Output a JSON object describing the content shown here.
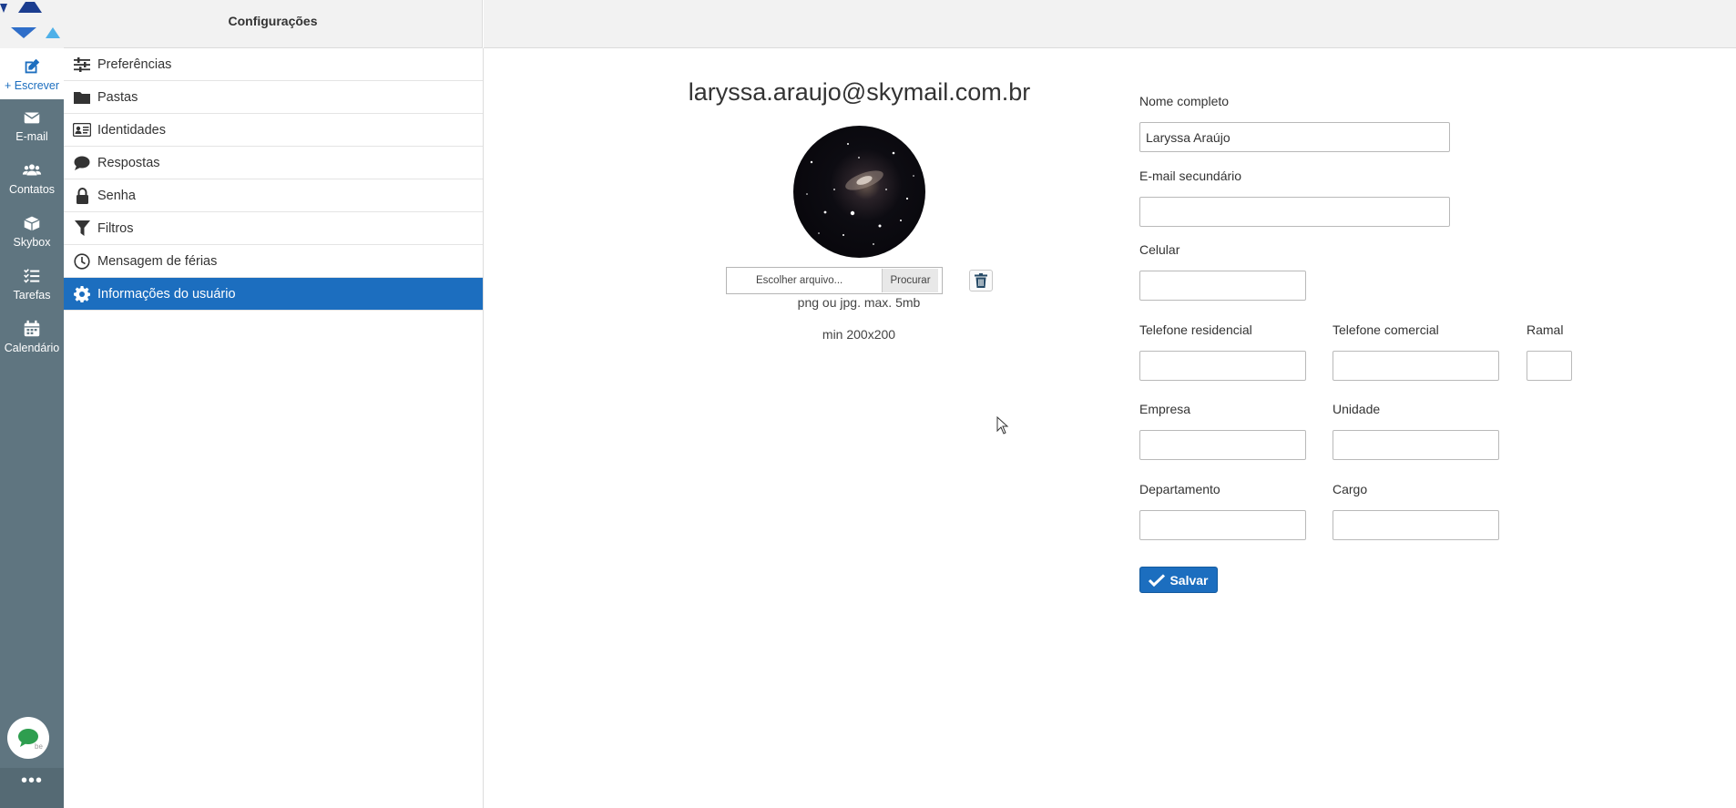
{
  "rail": {
    "write": "+ Escrever",
    "email": "E-mail",
    "contacts": "Contatos",
    "skybox": "Skybox",
    "tasks": "Tarefas",
    "calendar": "Calendário",
    "more": "•••"
  },
  "settings": {
    "title": "Configurações",
    "items": [
      {
        "label": "Preferências",
        "icon": "sliders-icon"
      },
      {
        "label": "Pastas",
        "icon": "folder-icon"
      },
      {
        "label": "Identidades",
        "icon": "id-card-icon"
      },
      {
        "label": "Respostas",
        "icon": "comment-icon"
      },
      {
        "label": "Senha",
        "icon": "lock-icon"
      },
      {
        "label": "Filtros",
        "icon": "filter-icon"
      },
      {
        "label": "Mensagem de férias",
        "icon": "clock-icon"
      },
      {
        "label": "Informações do usuário",
        "icon": "gear-icon",
        "active": true
      }
    ]
  },
  "profile": {
    "email": "laryssa.araujo@skymail.com.br",
    "file_placeholder": "Escolher arquivo...",
    "browse": "Procurar",
    "hint1": "png ou jpg. max. 5mb",
    "hint2": "min 200x200"
  },
  "form": {
    "full_name_label": "Nome completo",
    "full_name_value": "Laryssa Araújo",
    "secondary_email_label": "E-mail secundário",
    "cell_label": "Celular",
    "home_phone_label": "Telefone residencial",
    "work_phone_label": "Telefone comercial",
    "ext_label": "Ramal",
    "company_label": "Empresa",
    "unit_label": "Unidade",
    "department_label": "Departamento",
    "role_label": "Cargo",
    "save": "Salvar"
  },
  "colors": {
    "accent": "#1c6ebf",
    "rail": "#5f7580"
  }
}
